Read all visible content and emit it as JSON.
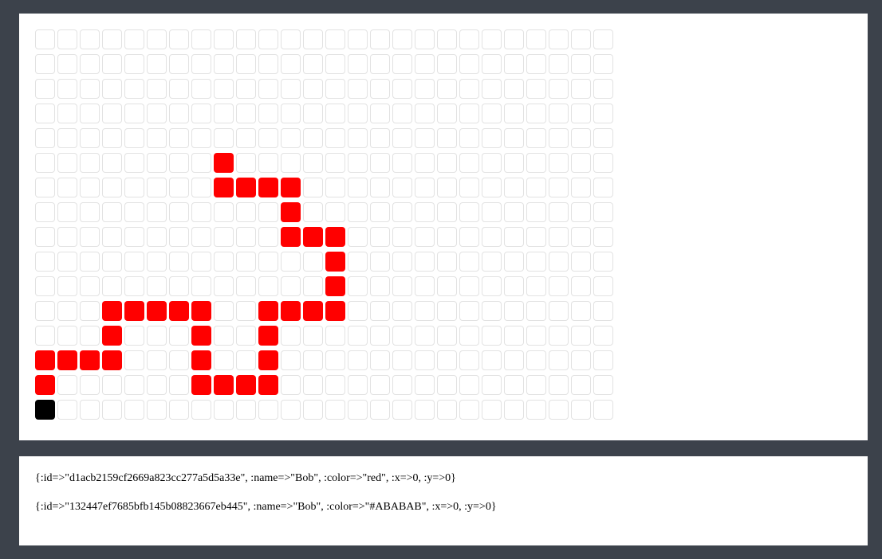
{
  "board": {
    "columns": 26,
    "rows": 16,
    "empty_color": "#FFFFFF",
    "empty_border_color": "#E2E2E2",
    "filled": [
      {
        "col": 8,
        "row": 5,
        "color": "#FF0000"
      },
      {
        "col": 8,
        "row": 6,
        "color": "#FF0000"
      },
      {
        "col": 9,
        "row": 6,
        "color": "#FF0000"
      },
      {
        "col": 10,
        "row": 6,
        "color": "#FF0000"
      },
      {
        "col": 11,
        "row": 6,
        "color": "#FF0000"
      },
      {
        "col": 11,
        "row": 7,
        "color": "#FF0000"
      },
      {
        "col": 11,
        "row": 8,
        "color": "#FF0000"
      },
      {
        "col": 12,
        "row": 8,
        "color": "#FF0000"
      },
      {
        "col": 13,
        "row": 8,
        "color": "#FF0000"
      },
      {
        "col": 13,
        "row": 9,
        "color": "#FF0000"
      },
      {
        "col": 13,
        "row": 10,
        "color": "#FF0000"
      },
      {
        "col": 3,
        "row": 11,
        "color": "#FF0000"
      },
      {
        "col": 4,
        "row": 11,
        "color": "#FF0000"
      },
      {
        "col": 5,
        "row": 11,
        "color": "#FF0000"
      },
      {
        "col": 6,
        "row": 11,
        "color": "#FF0000"
      },
      {
        "col": 7,
        "row": 11,
        "color": "#FF0000"
      },
      {
        "col": 10,
        "row": 11,
        "color": "#FF0000"
      },
      {
        "col": 11,
        "row": 11,
        "color": "#FF0000"
      },
      {
        "col": 12,
        "row": 11,
        "color": "#FF0000"
      },
      {
        "col": 13,
        "row": 11,
        "color": "#FF0000"
      },
      {
        "col": 3,
        "row": 12,
        "color": "#FF0000"
      },
      {
        "col": 7,
        "row": 12,
        "color": "#FF0000"
      },
      {
        "col": 10,
        "row": 12,
        "color": "#FF0000"
      },
      {
        "col": 0,
        "row": 13,
        "color": "#FF0000"
      },
      {
        "col": 1,
        "row": 13,
        "color": "#FF0000"
      },
      {
        "col": 2,
        "row": 13,
        "color": "#FF0000"
      },
      {
        "col": 3,
        "row": 13,
        "color": "#FF0000"
      },
      {
        "col": 7,
        "row": 13,
        "color": "#FF0000"
      },
      {
        "col": 10,
        "row": 13,
        "color": "#FF0000"
      },
      {
        "col": 0,
        "row": 14,
        "color": "#FF0000"
      },
      {
        "col": 7,
        "row": 14,
        "color": "#FF0000"
      },
      {
        "col": 8,
        "row": 14,
        "color": "#FF0000"
      },
      {
        "col": 9,
        "row": 14,
        "color": "#FF0000"
      },
      {
        "col": 10,
        "row": 14,
        "color": "#FF0000"
      },
      {
        "col": 0,
        "row": 15,
        "color": "#000000"
      }
    ]
  },
  "log": {
    "lines": [
      "{:id=>\"d1acb2159cf2669a823cc277a5d5a33e\", :name=>\"Bob\", :color=>\"red\", :x=>0, :y=>0}",
      "{:id=>\"132447ef7685bfb145b08823667eb445\", :name=>\"Bob\", :color=>\"#ABABAB\", :x=>0, :y=>0}"
    ]
  }
}
